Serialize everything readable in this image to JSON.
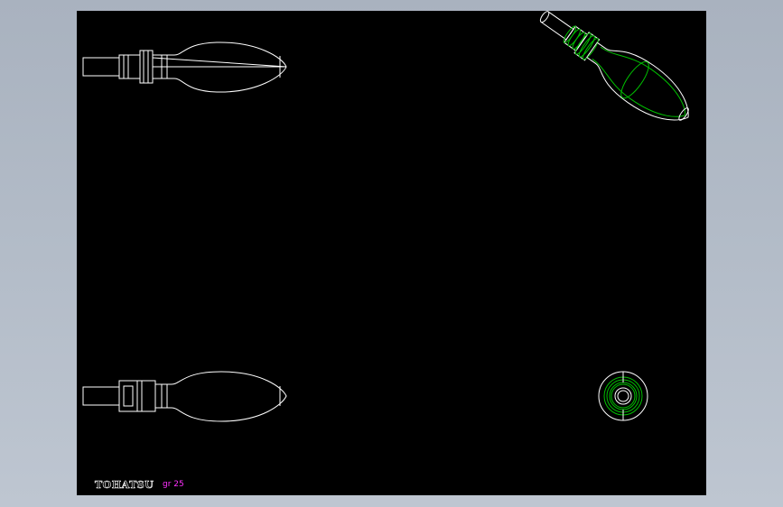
{
  "drawing": {
    "brand_text": "TOHATSU",
    "part_label": "gr 25",
    "background_color": "#000000",
    "line_color": "#ffffff",
    "model_color": "#00c000",
    "label_color": "#ff30ff"
  }
}
